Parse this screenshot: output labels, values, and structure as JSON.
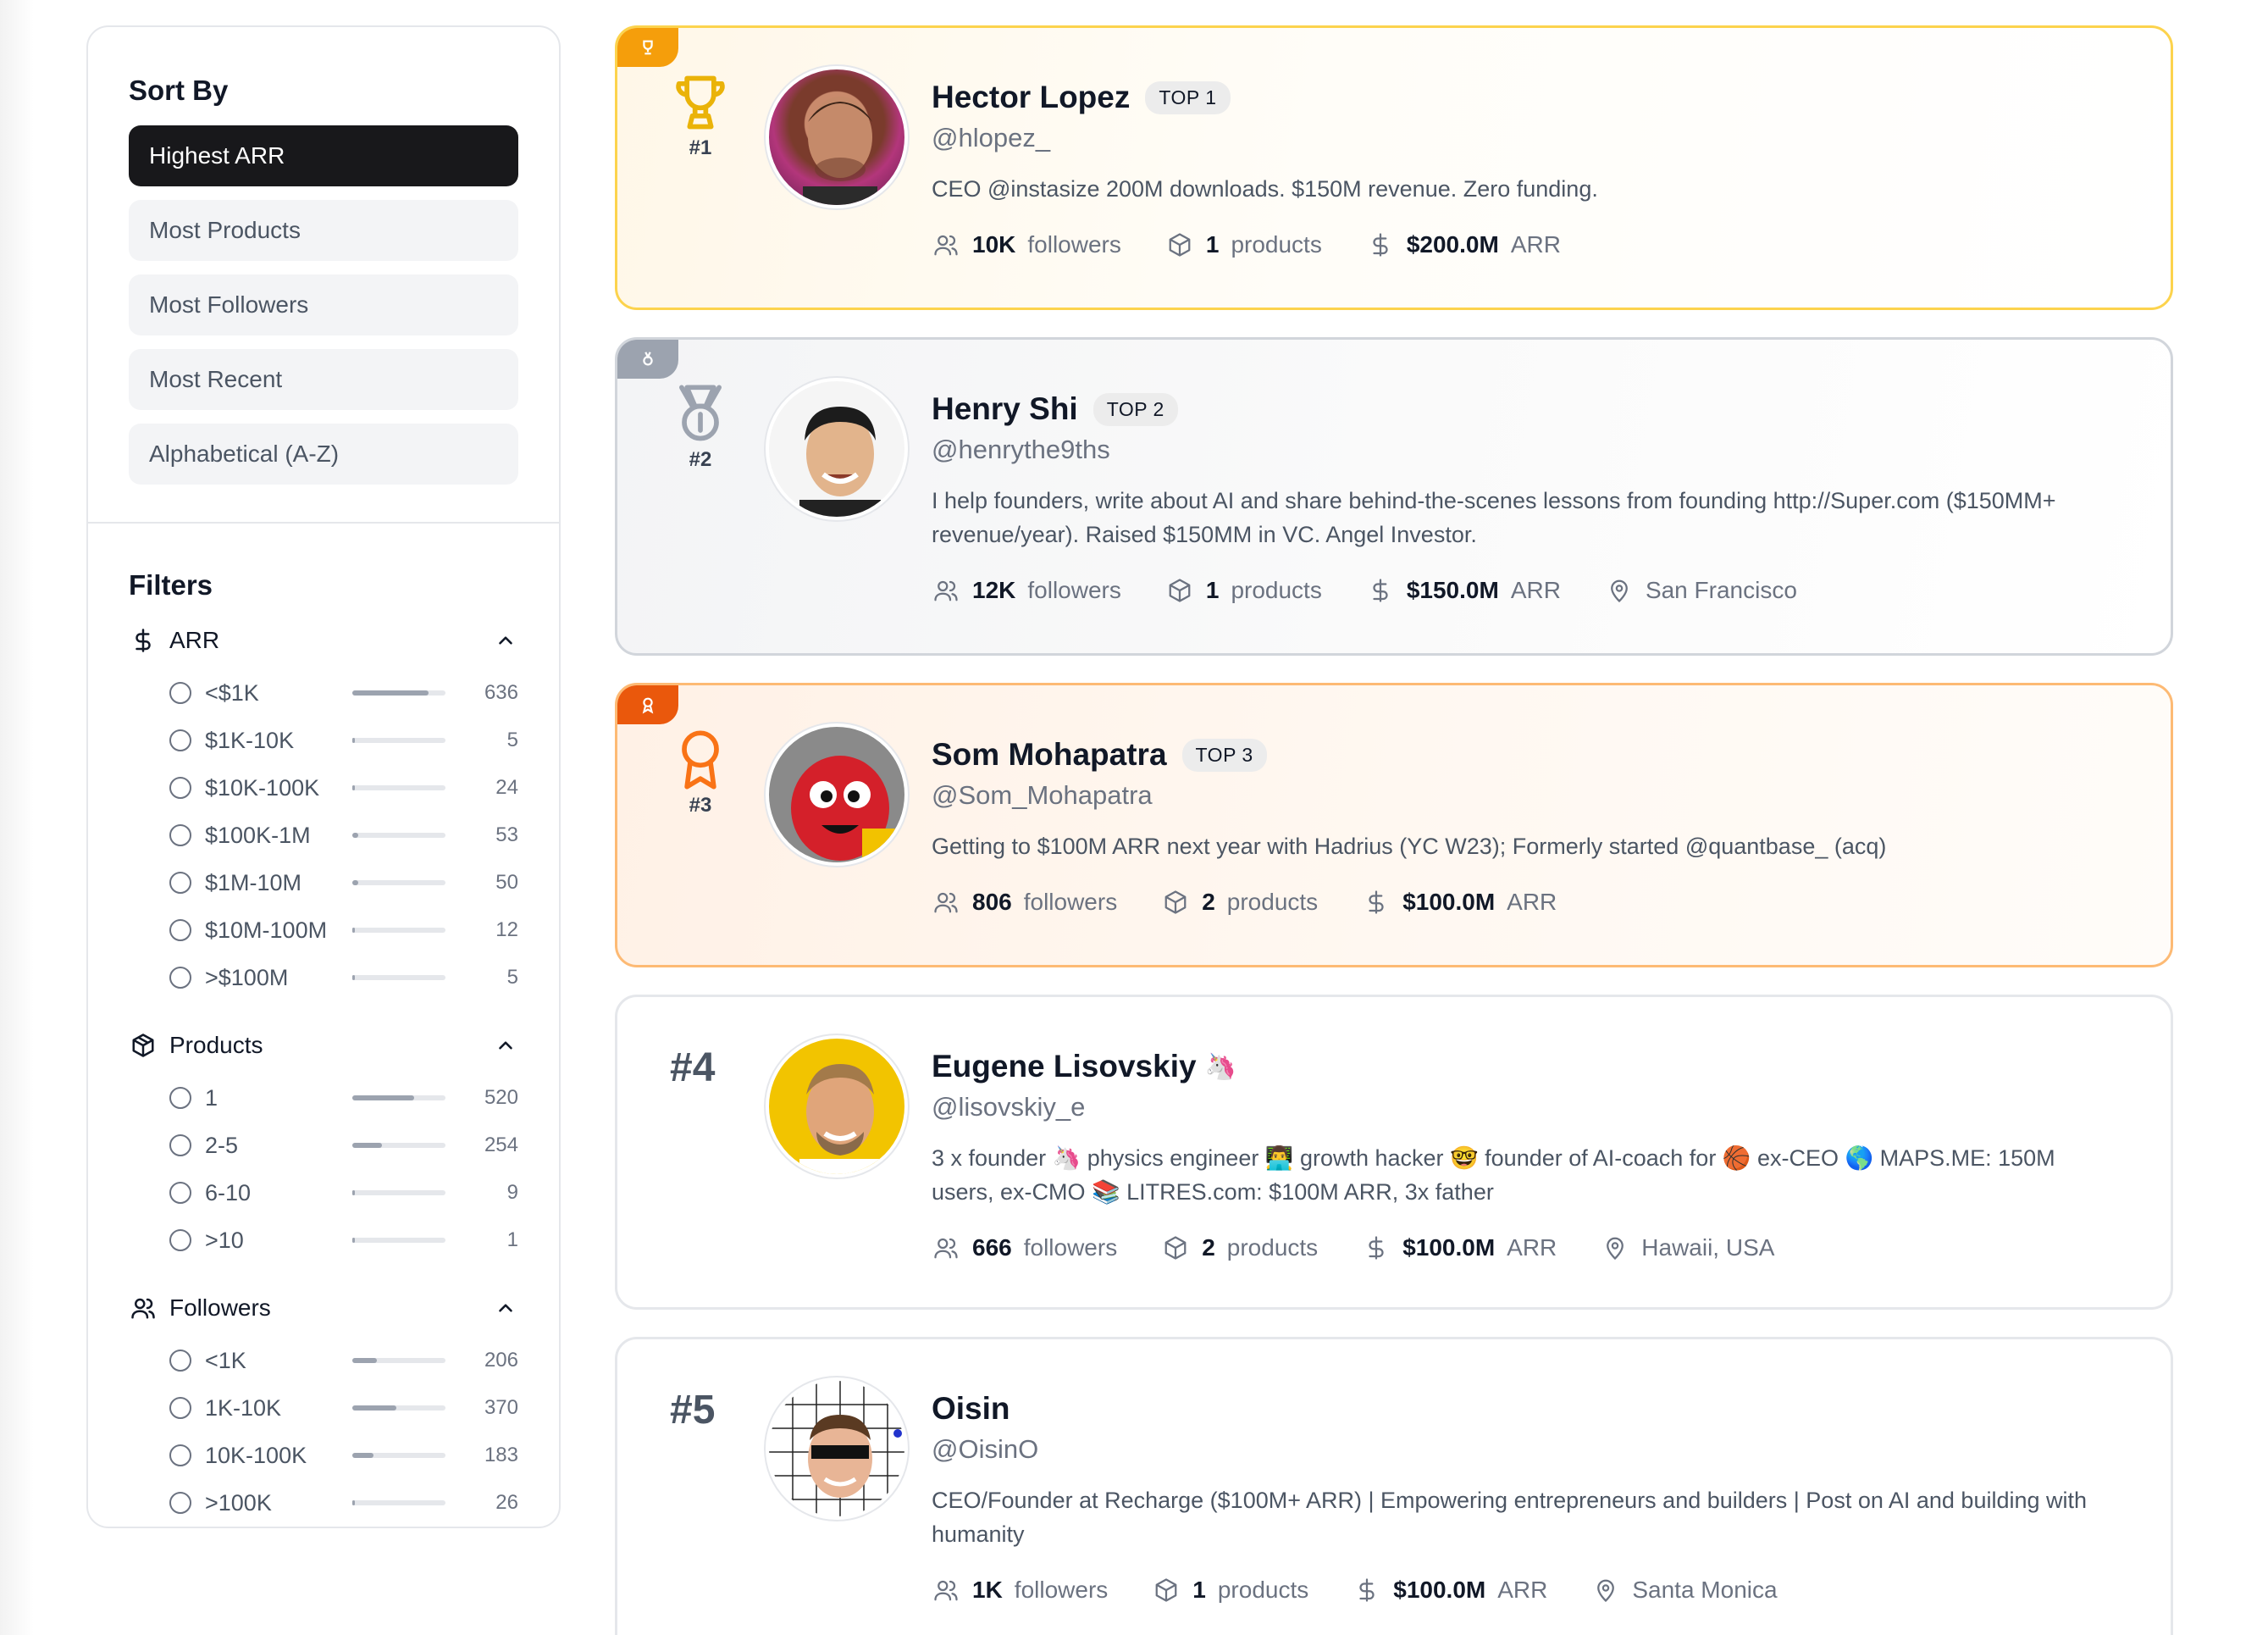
{
  "sort": {
    "title": "Sort By",
    "options": [
      {
        "label": "Highest ARR",
        "active": true
      },
      {
        "label": "Most Products",
        "active": false
      },
      {
        "label": "Most Followers",
        "active": false
      },
      {
        "label": "Most Recent",
        "active": false
      },
      {
        "label": "Alphabetical (A-Z)",
        "active": false
      }
    ]
  },
  "filters": {
    "title": "Filters",
    "arr": {
      "label": "ARR",
      "icon": "dollar-icon",
      "items": [
        {
          "label": "<$1K",
          "count": "636",
          "share": 0.82
        },
        {
          "label": "$1K-10K",
          "count": "5",
          "share": 0.01
        },
        {
          "label": "$10K-100K",
          "count": "24",
          "share": 0.03
        },
        {
          "label": "$100K-1M",
          "count": "53",
          "share": 0.06
        },
        {
          "label": "$1M-10M",
          "count": "50",
          "share": 0.06
        },
        {
          "label": "$10M-100M",
          "count": "12",
          "share": 0.02
        },
        {
          "label": ">$100M",
          "count": "5",
          "share": 0.01
        }
      ]
    },
    "products": {
      "label": "Products",
      "icon": "package-icon",
      "items": [
        {
          "label": "1",
          "count": "520",
          "share": 0.66
        },
        {
          "label": "2-5",
          "count": "254",
          "share": 0.32
        },
        {
          "label": "6-10",
          "count": "9",
          "share": 0.01
        },
        {
          "label": ">10",
          "count": "1",
          "share": 0.005
        }
      ]
    },
    "followers": {
      "label": "Followers",
      "icon": "users-icon",
      "items": [
        {
          "label": "<1K",
          "count": "206",
          "share": 0.26
        },
        {
          "label": "1K-10K",
          "count": "370",
          "share": 0.47
        },
        {
          "label": "10K-100K",
          "count": "183",
          "share": 0.23
        },
        {
          "label": ">100K",
          "count": "26",
          "share": 0.03
        }
      ]
    }
  },
  "labels": {
    "followers": "followers",
    "products": "products",
    "arr": "ARR"
  },
  "founders": [
    {
      "rank": "#1",
      "badge": "TOP 1",
      "tier": "gold",
      "medal_icon": "trophy-icon",
      "name": "Hector Lopez",
      "handle": "@hlopez_",
      "bio": "CEO @instasize 200M downloads. $150M revenue. Zero funding.",
      "followers": "10K",
      "products": "1",
      "arr": "$200.0M",
      "location": ""
    },
    {
      "rank": "#2",
      "badge": "TOP 2",
      "tier": "silver",
      "medal_icon": "medal-icon",
      "name": "Henry Shi",
      "handle": "@henrythe9ths",
      "bio": "I help founders, write about AI and share behind-the-scenes lessons from founding http://Super.com ($150MM+ revenue/year). Raised $150MM in VC. Angel Investor.",
      "followers": "12K",
      "products": "1",
      "arr": "$150.0M",
      "location": "San Francisco"
    },
    {
      "rank": "#3",
      "badge": "TOP 3",
      "tier": "bronze",
      "medal_icon": "award-icon",
      "name": "Som Mohapatra",
      "handle": "@Som_Mohapatra",
      "bio": "Getting to $100M ARR next year with Hadrius (YC W23); Formerly started @quantbase_ (acq)",
      "followers": "806",
      "products": "2",
      "arr": "$100.0M",
      "location": ""
    },
    {
      "rank": "#4",
      "badge": "",
      "tier": "plain",
      "name_emoji": "🦄",
      "name": "Eugene Lisovskiy",
      "handle": "@lisovskiy_e",
      "bio": "3 x founder 🦄 physics engineer 👨‍💻 growth hacker 🤓 founder of AI-coach for 🏀 ex-CEO 🌎 MAPS.ME: 150M users, ex-CMO 📚 LITRES.com: $100M ARR, 3x father",
      "followers": "666",
      "products": "2",
      "arr": "$100.0M",
      "location": "Hawaii, USA"
    },
    {
      "rank": "#5",
      "badge": "",
      "tier": "plain",
      "name": "Oisin",
      "handle": "@OisinO",
      "bio": "CEO/Founder at Recharge ($100M+ ARR) | Empowering entrepreneurs and builders | Post on AI and building with humanity",
      "followers": "1K",
      "products": "1",
      "arr": "$100.0M",
      "location": "Santa Monica"
    }
  ]
}
